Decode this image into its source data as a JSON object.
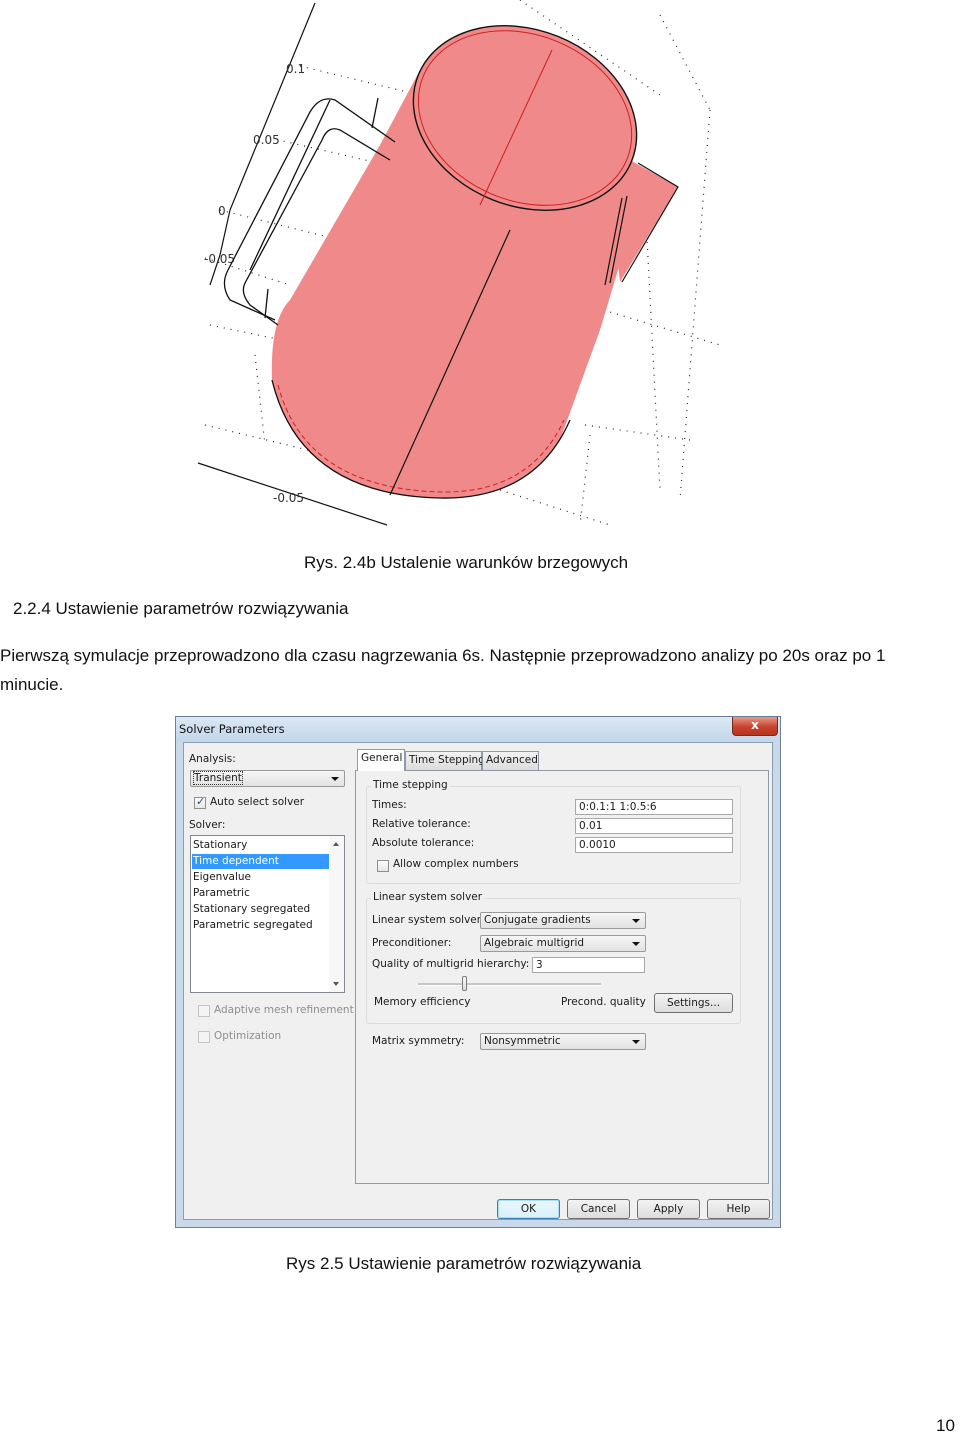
{
  "figure1": {
    "axis_ticks": [
      "0.1",
      "0.05",
      "0",
      "-0.05",
      "-0.05"
    ],
    "fill_color": "#f08a8a",
    "edge_color": "#cc1f1f",
    "caption": "Rys. 2.4b Ustalenie warunków brzegowych"
  },
  "section": {
    "heading": "2.2.4 Ustawienie parametrów rozwiązywania",
    "paragraph_line1": "Pierwszą symulacje przeprowadzono dla czasu nagrzewania 6s. Następnie przeprowadzono analizy po 20s oraz po 1",
    "paragraph_line2": "minucie."
  },
  "dialog": {
    "title": "Solver Parameters",
    "close_label": "x",
    "analysis": {
      "label": "Analysis:",
      "value": "Transient",
      "auto_select_label": "Auto select solver",
      "auto_select_checked": true
    },
    "solver": {
      "label": "Solver:",
      "items": [
        "Stationary",
        "Time dependent",
        "Eigenvalue",
        "Parametric",
        "Stationary segregated",
        "Parametric segregated"
      ],
      "selected": "Time dependent"
    },
    "adaptive_mesh_label": "Adaptive mesh refinement",
    "optimization_label": "Optimization",
    "tabs": [
      "General",
      "Time Stepping",
      "Advanced"
    ],
    "active_tab": "General",
    "time_stepping": {
      "group_title": "Time stepping",
      "times_label": "Times:",
      "times_value": "0:0.1:1 1:0.5:6",
      "rel_tol_label": "Relative tolerance:",
      "rel_tol_value": "0.01",
      "abs_tol_label": "Absolute tolerance:",
      "abs_tol_value": "0.0010",
      "complex_label": "Allow complex numbers",
      "complex_checked": false
    },
    "linear_solver": {
      "group_title": "Linear system solver",
      "solver_label": "Linear system solver:",
      "solver_value": "Conjugate gradients",
      "precond_label": "Preconditioner:",
      "precond_value": "Algebraic multigrid",
      "quality_label": "Quality of multigrid hierarchy:",
      "quality_value": "3",
      "slider_left_label": "Memory efficiency",
      "slider_right_label": "Precond. quality",
      "slider_position": 0.25,
      "settings_label": "Settings..."
    },
    "matrix_symmetry": {
      "label": "Matrix symmetry:",
      "value": "Nonsymmetric"
    },
    "buttons": {
      "ok": "OK",
      "cancel": "Cancel",
      "apply": "Apply",
      "help": "Help"
    }
  },
  "figure2_caption": "Rys 2.5 Ustawienie parametrów rozwiązywania",
  "page_number": "10"
}
